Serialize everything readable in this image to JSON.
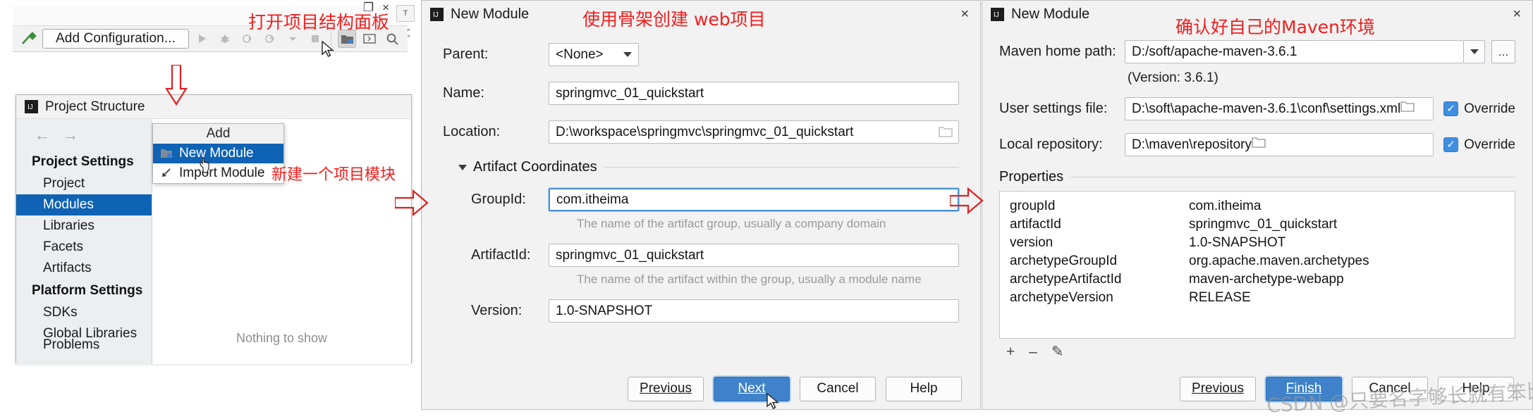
{
  "left_pane": {
    "toolbar": {
      "hammer_icon": "build-hammer-icon",
      "add_configuration_label": "Add Configuration...",
      "run_icon": "run-play-icon",
      "debug_icon": "debug-bug-icon",
      "run_coverage_icon": "run-with-coverage-icon",
      "profile_icon": "profiler-icon",
      "dropdown_icon": "chevron-down-icon",
      "stop_icon": "stop-square-icon",
      "project_structure_icon": "project-structure-icon",
      "terminal_icon": "terminal-icon",
      "search_icon": "search-icon",
      "vtab_top": "T",
      "vtab_bottom": "文",
      "win_minimize": "–",
      "win_maximize": "❐",
      "win_close": "×"
    },
    "project_structure": {
      "title": "Project Structure",
      "nav_back": "←",
      "nav_forward": "→",
      "groups": [
        {
          "label": "Project Settings",
          "items": [
            "Project",
            "Modules",
            "Libraries",
            "Facets",
            "Artifacts"
          ],
          "selected": "Modules"
        },
        {
          "label": "Platform Settings",
          "items": [
            "SDKs",
            "Global Libraries"
          ]
        }
      ],
      "bottom_item": "Problems",
      "toolbar": {
        "add": "+",
        "remove": "–",
        "copy": "❐"
      },
      "empty_text": "Nothing to show",
      "add_menu": {
        "header": "Add",
        "items": [
          {
            "label": "New Module",
            "icon": "module-folder-icon",
            "selected": true
          },
          {
            "label": "Import Module",
            "icon": "import-arrow-icon",
            "selected": false
          }
        ]
      }
    }
  },
  "new_module_dialog": {
    "title": "New Module",
    "close": "×",
    "fields": {
      "parent_label": "Parent:",
      "parent_value": "<None>",
      "name_label": "Name:",
      "name_value": "springmvc_01_quickstart",
      "location_label": "Location:",
      "location_value": "D:\\workspace\\springmvc\\springmvc_01_quickstart"
    },
    "section_title": "Artifact Coordinates",
    "coordinates": {
      "groupid_label": "GroupId:",
      "groupid_value": "com.itheima",
      "groupid_hint": "The name of the artifact group, usually a company domain",
      "artifactid_label": "ArtifactId:",
      "artifactid_value": "springmvc_01_quickstart",
      "artifactid_hint": "The name of the artifact within the group, usually a module name",
      "version_label": "Version:",
      "version_value": "1.0-SNAPSHOT"
    },
    "buttons": {
      "previous": "Previous",
      "next": "Next",
      "cancel": "Cancel",
      "help": "Help"
    }
  },
  "maven_dialog": {
    "title": "New Module",
    "close": "×",
    "maven_home_label": "Maven home path:",
    "maven_home_value": "D:/soft/apache-maven-3.6.1",
    "version_line": "(Version: 3.6.1)",
    "user_settings_label": "User settings file:",
    "user_settings_value": "D:\\soft\\apache-maven-3.6.1\\conf\\settings.xml",
    "user_settings_override": "Override",
    "local_repo_label": "Local repository:",
    "local_repo_value": "D:\\maven\\repository",
    "local_repo_override": "Override",
    "properties_title": "Properties",
    "properties_rows": [
      {
        "key": "groupId",
        "value": "com.itheima"
      },
      {
        "key": "artifactId",
        "value": "springmvc_01_quickstart"
      },
      {
        "key": "version",
        "value": "1.0-SNAPSHOT"
      },
      {
        "key": "archetypeGroupId",
        "value": "org.apache.maven.archetypes"
      },
      {
        "key": "archetypeArtifactId",
        "value": "maven-archetype-webapp"
      },
      {
        "key": "archetypeVersion",
        "value": "RELEASE"
      }
    ],
    "props_tools": {
      "add": "+",
      "remove": "–",
      "edit": "✎"
    },
    "buttons": {
      "previous": "Previous",
      "finish": "Finish",
      "cancel": "Cancel",
      "help": "Help"
    }
  },
  "annotations": {
    "open_project_structure": "打开项目结构面板",
    "new_module_note": "新建一个项目模块",
    "use_skeleton": "使用骨架创建 web项目",
    "confirm_maven": "确认好自己的Maven环境"
  },
  "watermark": "CSDN @只要名字够长就有笨比跟着念",
  "colors": {
    "selection_blue": "#0f63b4",
    "annotation_red": "#f01f1f",
    "primary_button": "#3f82c9",
    "checkbox_blue": "#3f8fe0"
  }
}
